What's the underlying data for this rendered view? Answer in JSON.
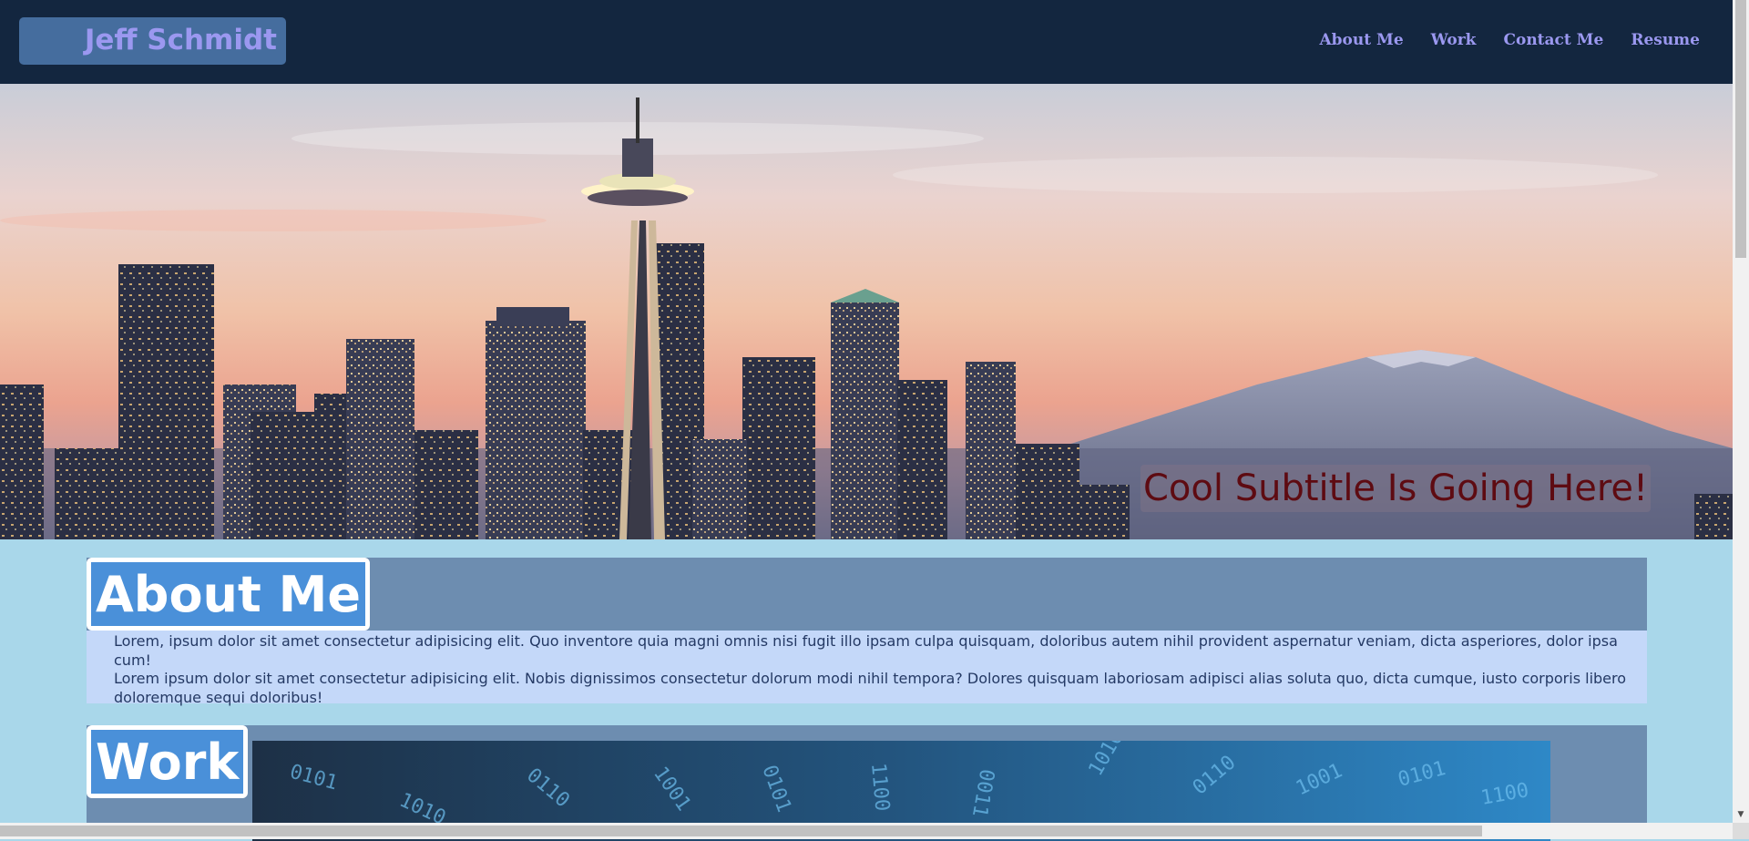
{
  "header": {
    "brand": "Jeff Schmidt",
    "nav": [
      {
        "label": "About Me"
      },
      {
        "label": "Work"
      },
      {
        "label": "Contact Me"
      },
      {
        "label": "Resume"
      }
    ]
  },
  "hero": {
    "subtitle": "Cool Subtitle Is Going Here!",
    "image": "seattle-skyline-space-needle-sunset"
  },
  "about": {
    "title": "About Me",
    "paragraphs": [
      "Lorem, ipsum dolor sit amet consectetur adipisicing elit. Quo inventore quia magni omnis nisi fugit illo ipsam culpa quisquam, doloribus autem nihil provident aspernatur veniam, dicta asperiores, dolor ipsa cum!",
      "Lorem ipsum dolor sit amet consectetur adipisicing elit. Nobis dignissimos consectetur dolorum modi nihil tempora? Dolores quisquam laboriosam adipisci alias soluta quo, dicta cumque, iusto corporis libero doloremque sequi doloribus!"
    ]
  },
  "work": {
    "title": "Work",
    "image": "binary-code-cylinder"
  },
  "colors": {
    "header_bg": "#13263f",
    "nav_text": "#9b98f0",
    "page_bg": "#a9d7ea",
    "section_head_bg": "#6d8db0",
    "section_body_bg": "#c4d8f9",
    "title_bg": "#4a90d9",
    "subtitle_text": "#5e0b12"
  },
  "scrollbars": {
    "vertical_icons": [
      "scroll-up-arrow-icon",
      "scroll-down-arrow-icon"
    ],
    "horizontal_icons": [
      "scroll-left-arrow-icon",
      "scroll-right-arrow-icon"
    ]
  }
}
